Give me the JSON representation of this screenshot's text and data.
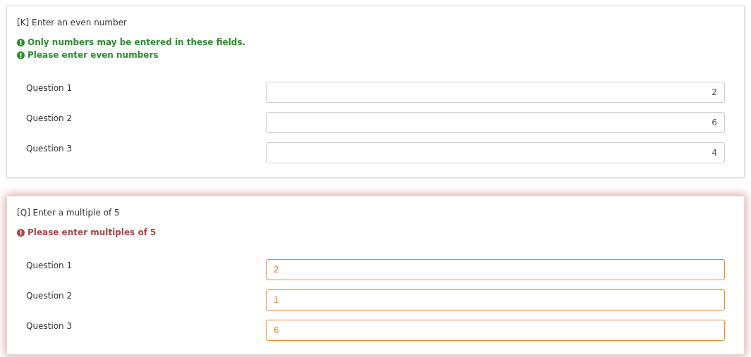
{
  "questions": [
    {
      "title": "[K] Enter an even number",
      "error": false,
      "messages": [
        "Only numbers may be entered in these fields.",
        "Please enter even numbers"
      ],
      "rows": [
        {
          "label": "Question 1",
          "value": "2"
        },
        {
          "label": "Question 2",
          "value": "6"
        },
        {
          "label": "Question 3",
          "value": "4"
        }
      ]
    },
    {
      "title": "[Q] Enter a multiple of 5",
      "error": true,
      "messages": [
        "Please enter multiples of 5"
      ],
      "rows": [
        {
          "label": "Question 1",
          "value": "2"
        },
        {
          "label": "Question 2",
          "value": "1"
        },
        {
          "label": "Question 3",
          "value": "6"
        }
      ]
    }
  ]
}
